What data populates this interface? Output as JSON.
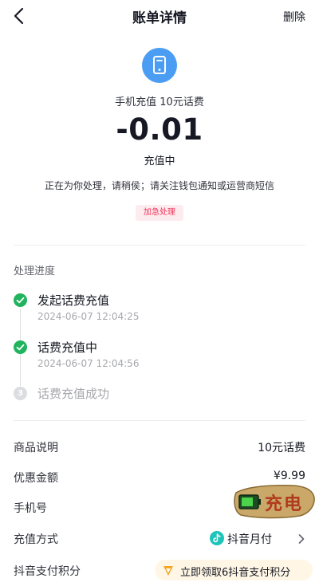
{
  "header": {
    "title": "账单详情",
    "delete_label": "删除"
  },
  "summary": {
    "product_icon": "phone-icon",
    "product_name": "手机充值 10元话费",
    "amount": "-0.01",
    "status": "充值中",
    "notice": "正在为你处理，请稍侯；请关注钱包通知或运营商短信",
    "urgent_label": "加急处理"
  },
  "progress": {
    "title": "处理进度",
    "steps": [
      {
        "label": "发起话费充值",
        "time": "2024-06-07 12:04:25",
        "state": "done"
      },
      {
        "label": "话费充值中",
        "time": "2024-06-07 12:04:56",
        "state": "done"
      },
      {
        "label": "话费充值成功",
        "number": "3",
        "state": "pending"
      }
    ]
  },
  "details": {
    "product_desc": {
      "label": "商品说明",
      "value": "10元话费"
    },
    "discount": {
      "label": "优惠金额",
      "value": "¥9.99"
    },
    "phone": {
      "label": "手机号",
      "value": ""
    },
    "pay_method": {
      "label": "充值方式",
      "value": "抖音月付"
    },
    "points": {
      "label": "抖音支付积分",
      "promo": "立即领取6抖音支付积分"
    }
  },
  "sticker": {
    "text": "充电"
  },
  "colors": {
    "success": "#22b35e",
    "accent": "#f2355a",
    "icon_blue": "#4a9df2"
  }
}
